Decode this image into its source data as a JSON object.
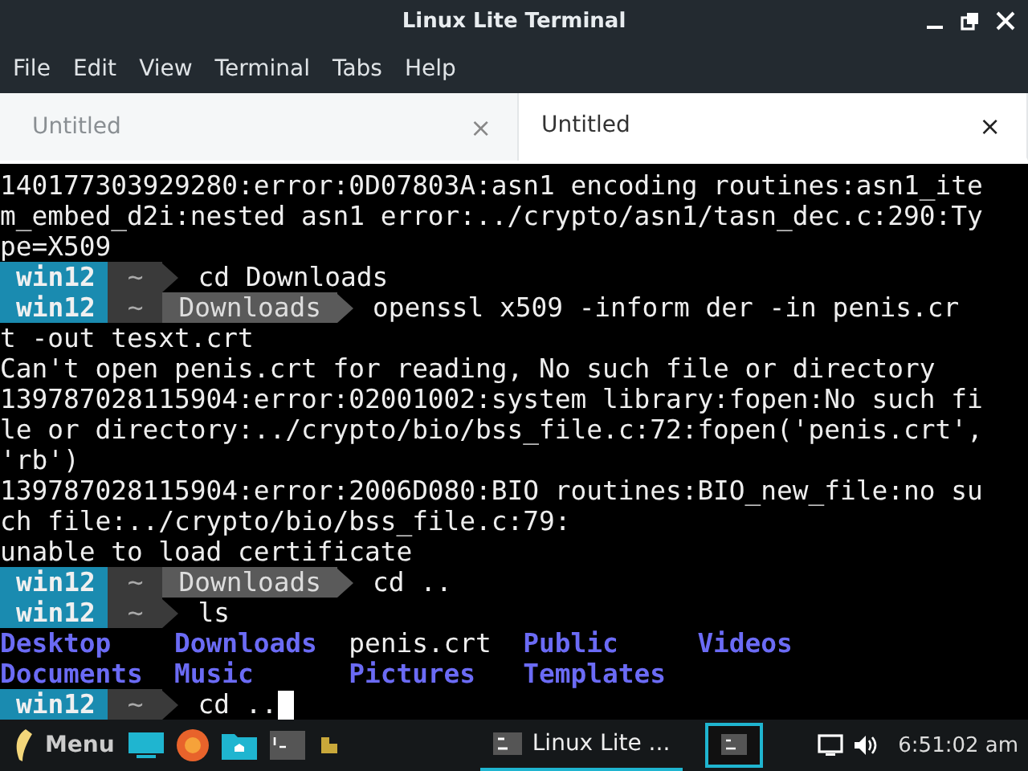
{
  "window": {
    "title": "Linux Lite Terminal"
  },
  "menu": [
    "File",
    "Edit",
    "View",
    "Terminal",
    "Tabs",
    "Help"
  ],
  "tabs": [
    {
      "label": "Untitled",
      "selected": false,
      "close": "×"
    },
    {
      "label": "Untitled",
      "selected": true,
      "close": "×"
    }
  ],
  "terminal": {
    "lines": [
      {
        "kind": "text",
        "text": "140177303929280:error:0D07803A:asn1 encoding routines:asn1_ite"
      },
      {
        "kind": "text",
        "text": "m_embed_d2i:nested asn1 error:../crypto/asn1/tasn_dec.c:290:Ty"
      },
      {
        "kind": "text",
        "text": "pe=X509"
      },
      {
        "kind": "prompt",
        "host": "win12",
        "home": "~",
        "command": "cd Downloads"
      },
      {
        "kind": "prompt",
        "host": "win12",
        "home": "~",
        "dirs": [
          "Downloads"
        ],
        "command": "openssl x509 -inform der -in penis.cr"
      },
      {
        "kind": "text",
        "text": "t -out tesxt.crt"
      },
      {
        "kind": "text",
        "text": "Can't open penis.crt for reading, No such file or directory"
      },
      {
        "kind": "text",
        "text": "139787028115904:error:02001002:system library:fopen:No such fi"
      },
      {
        "kind": "text",
        "text": "le or directory:../crypto/bio/bss_file.c:72:fopen('penis.crt',"
      },
      {
        "kind": "text",
        "text": "'rb')"
      },
      {
        "kind": "text",
        "text": "139787028115904:error:2006D080:BIO routines:BIO_new_file:no su"
      },
      {
        "kind": "text",
        "text": "ch file:../crypto/bio/bss_file.c:79:"
      },
      {
        "kind": "text",
        "text": "unable to load certificate"
      },
      {
        "kind": "prompt",
        "host": "win12",
        "home": "~",
        "dirs": [
          "Downloads"
        ],
        "command": "cd .."
      },
      {
        "kind": "prompt",
        "host": "win12",
        "home": "~",
        "command": "ls"
      },
      {
        "kind": "ls",
        "entries": [
          {
            "name": "Desktop",
            "kind": "dir"
          },
          {
            "name": "Downloads",
            "kind": "dir"
          },
          {
            "name": "penis.crt",
            "kind": "file"
          },
          {
            "name": "Public",
            "kind": "dir"
          },
          {
            "name": "Videos",
            "kind": "dir"
          }
        ]
      },
      {
        "kind": "ls",
        "entries": [
          {
            "name": "Documents",
            "kind": "dir"
          },
          {
            "name": "Music",
            "kind": "dir"
          },
          {
            "name": "Pictures",
            "kind": "dir"
          },
          {
            "name": "Templates",
            "kind": "dir"
          }
        ]
      },
      {
        "kind": "input",
        "host": "win12",
        "home": "~",
        "command": "cd .."
      }
    ]
  },
  "taskbar": {
    "menu_label": "Menu",
    "tasks": [
      {
        "label": "Linux Lite ...",
        "selected": true
      }
    ],
    "clock": "6:51:02 am"
  }
}
